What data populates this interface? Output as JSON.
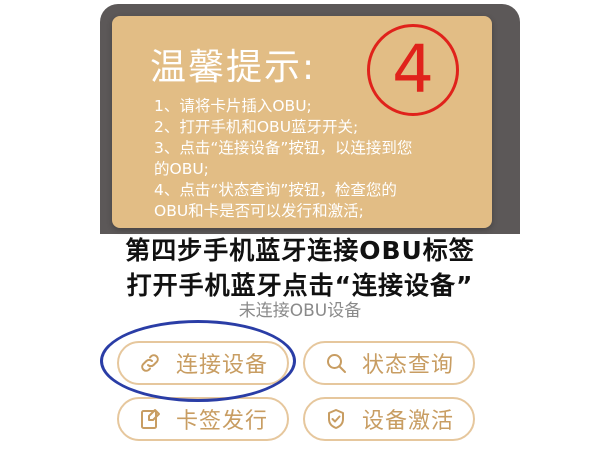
{
  "tip_card": {
    "title": "温馨提示:",
    "step_number": "4",
    "items": [
      "1、请将卡片插入OBU;",
      "2、打开手机和OBU蓝牙开关;",
      "3、点击“连接设备”按钮，以连接到您",
      "的OBU;",
      "4、点击“状态查询”按钮，检查您的",
      "OBU和卡是否可以发行和激活;"
    ]
  },
  "caption": {
    "line1": "第四步手机蓝牙连接OBU标签",
    "line2": "打开手机蓝牙点击“连接设备”"
  },
  "status_text": "未连接OBU设备",
  "buttons": {
    "connect": {
      "label": "连接设备",
      "icon": "link-icon"
    },
    "status": {
      "label": "状态查询",
      "icon": "search-icon"
    },
    "issue": {
      "label": "卡签发行",
      "icon": "card-edit-icon"
    },
    "activate": {
      "label": "设备激活",
      "icon": "check-shield-icon"
    }
  },
  "colors": {
    "card_bg": "#e2bd85",
    "button_text": "#c89d62",
    "button_border": "#e6c79d",
    "highlight": "#2a3da6",
    "badge": "#e0221b"
  }
}
